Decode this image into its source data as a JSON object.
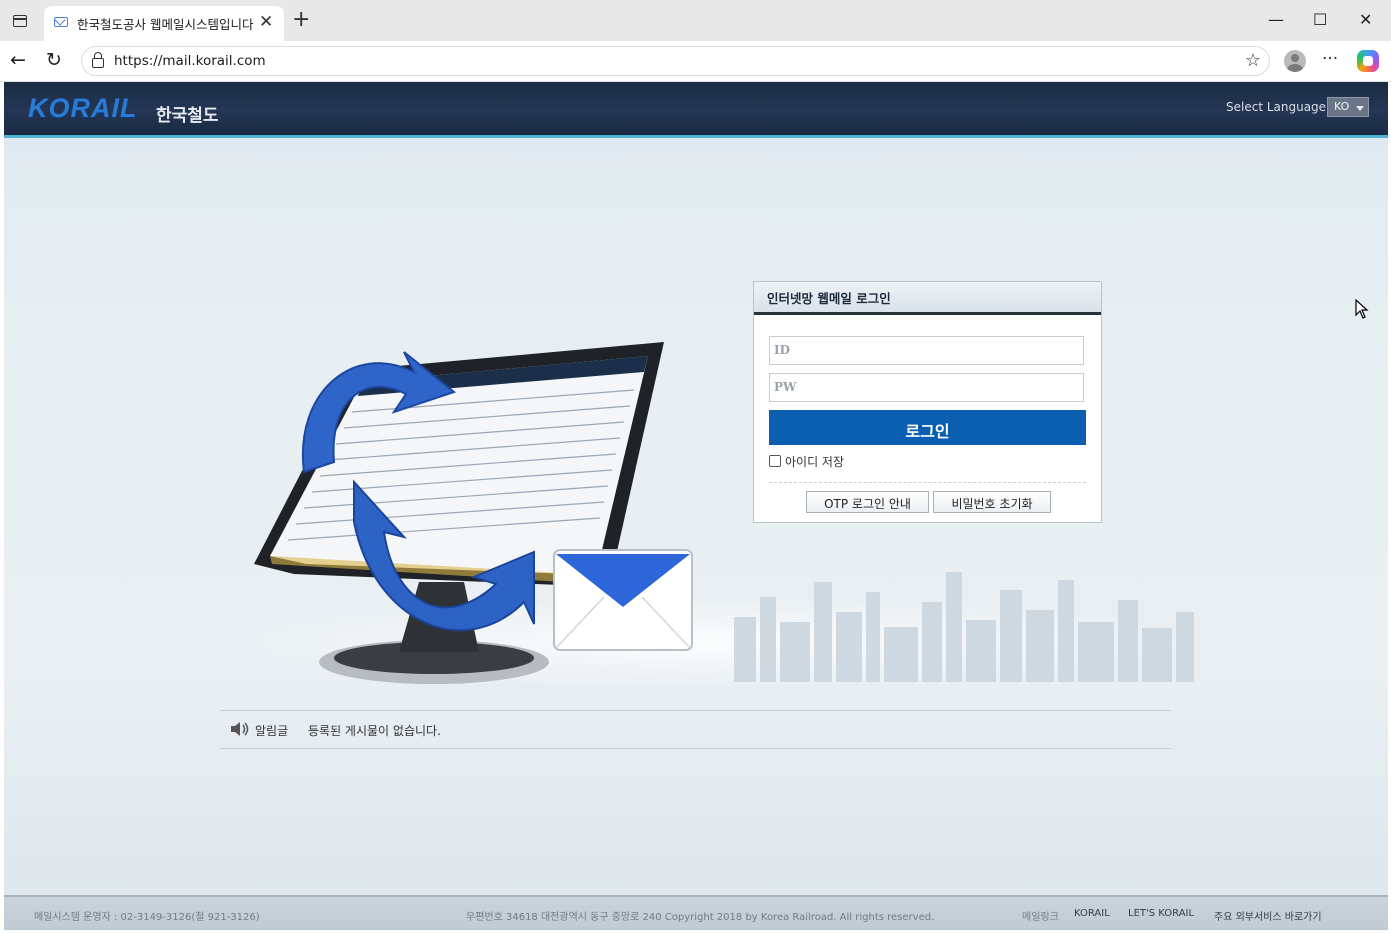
{
  "browser": {
    "tab_title": "한국철도공사 웹메일시스템입니다",
    "tab_close": "✕",
    "new_tab": "+",
    "url": "https://mail.korail.com",
    "window_controls": {
      "minimize": "—",
      "maximize": "☐",
      "close": "✕"
    },
    "back": "←",
    "reload": "↻",
    "star": "☆",
    "more": "···"
  },
  "header": {
    "logo_text": "KORAIL",
    "logo_korean": "한국철도",
    "language_label": "Select Language",
    "language_value": "KO",
    "accent_color": "#4fb3d6"
  },
  "login": {
    "title": "인터넷망 웹메일 로그인",
    "id_placeholder": "ID",
    "pw_placeholder": "PW",
    "login_button": "로그인",
    "save_id_label": "아이디 저장",
    "otp_button": "OTP 로그인 안내",
    "reset_password_button": "비밀번호 초기화",
    "button_color": "#0b5fb0"
  },
  "notice": {
    "label": "알림글",
    "message": "등록된 게시물이 없습니다."
  },
  "footer": {
    "contact": "메일시스템 운영자 : 02-3149-3126(철 921-3126)",
    "address": "우편번호 34618 대전광역시 동구 중앙로 240 Copyright 2018 by Korea Railroad. All rights reserved.",
    "mail_link_label": "메일링크",
    "links": [
      "KORAIL",
      "LET'S KORAIL",
      "주요 외부서비스 바로가기"
    ]
  }
}
